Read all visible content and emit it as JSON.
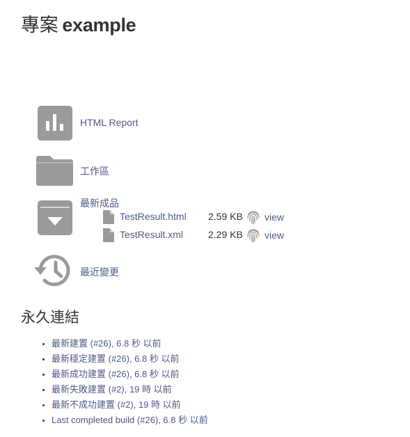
{
  "page": {
    "title_prefix": "專案",
    "title_name": "example"
  },
  "actions": [
    {
      "label": "HTML Report",
      "icon": "bar-chart-icon"
    },
    {
      "label": "工作區",
      "icon": "folder-icon"
    },
    {
      "label": "最新成品",
      "icon": "archive-download-icon"
    },
    {
      "label": "最近變更",
      "icon": "history-icon"
    }
  ],
  "artifacts": [
    {
      "name": "TestResult.html",
      "size": "2.59 KB",
      "view": "view"
    },
    {
      "name": "TestResult.xml",
      "size": "2.29 KB",
      "view": "view"
    }
  ],
  "permalinks": {
    "title": "永久連結",
    "items": [
      "最新建置 (#26), 6.8 秒 以前",
      "最新穩定建置 (#26), 6.8 秒 以前",
      "最新成功建置 (#26), 6.8 秒 以前",
      "最新失敗建置 (#2), 19 時 以前",
      "最新不成功建置 (#2), 19 時 以前",
      "Last completed build (#26), 6.8 秒 以前"
    ]
  },
  "colors": {
    "link": "#4d5a87",
    "icon": "#9a9a9a",
    "text": "#333333"
  }
}
